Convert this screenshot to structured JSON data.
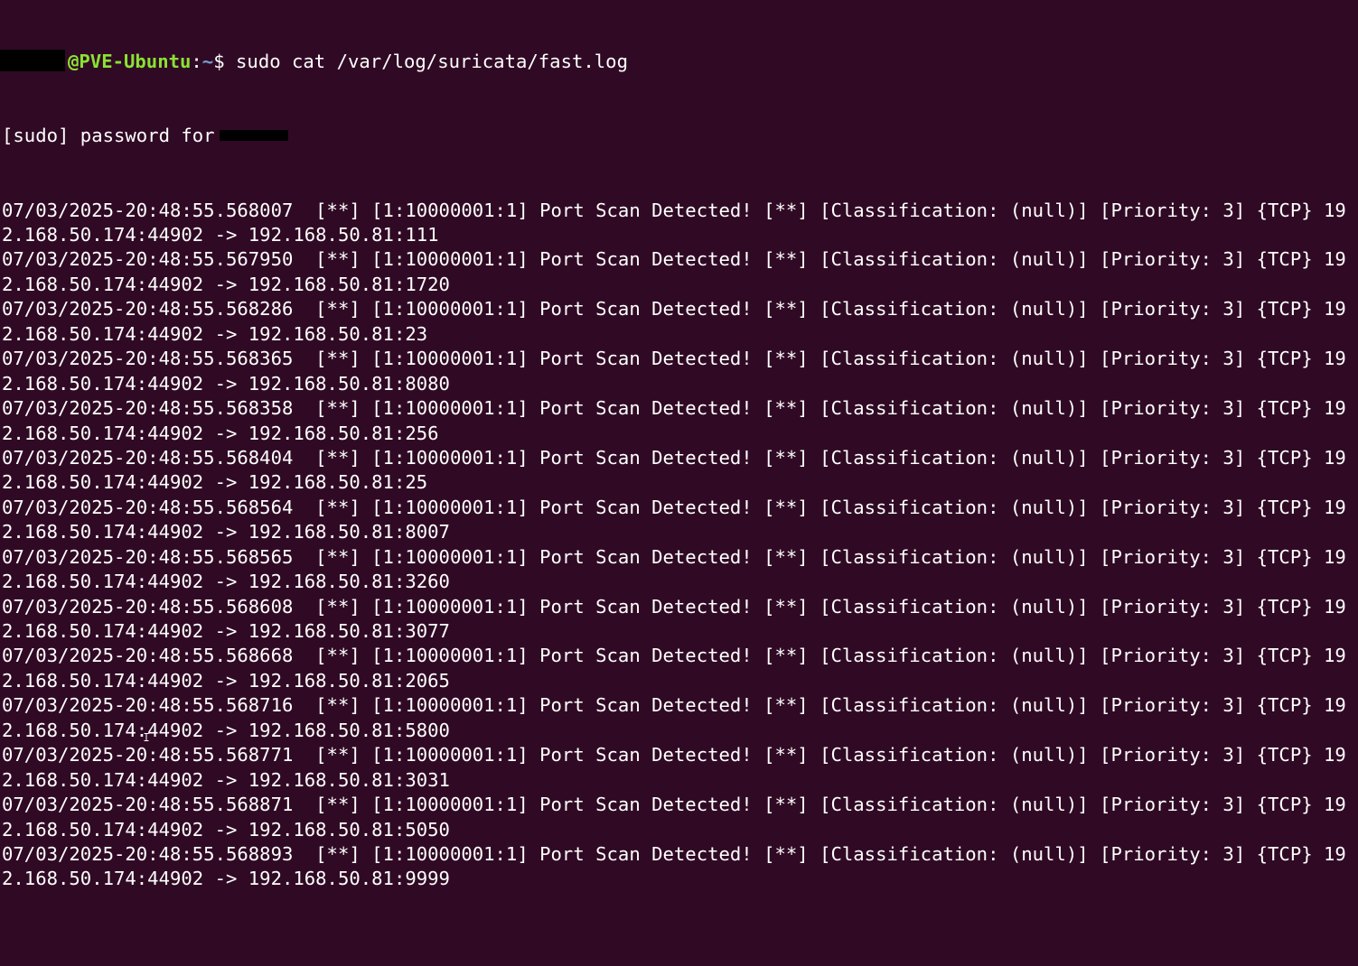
{
  "prompt": {
    "host": "@PVE-Ubuntu",
    "separator": ":",
    "path": "~",
    "symbol": "$",
    "command": "sudo cat /var/log/suricata/fast.log"
  },
  "sudo_prompt": "[sudo] password for",
  "entries": [
    {
      "head": "07/03/2025-20:48:55.568007  [**] [1:10000001:1] Port Scan Detected! [**] [Classification: (null)] [Priority: 3] {TCP} 19",
      "tail": "2.168.50.174:44902 -> 192.168.50.81:111"
    },
    {
      "head": "07/03/2025-20:48:55.567950  [**] [1:10000001:1] Port Scan Detected! [**] [Classification: (null)] [Priority: 3] {TCP} 19",
      "tail": "2.168.50.174:44902 -> 192.168.50.81:1720"
    },
    {
      "head": "07/03/2025-20:48:55.568286  [**] [1:10000001:1] Port Scan Detected! [**] [Classification: (null)] [Priority: 3] {TCP} 19",
      "tail": "2.168.50.174:44902 -> 192.168.50.81:23"
    },
    {
      "head": "07/03/2025-20:48:55.568365  [**] [1:10000001:1] Port Scan Detected! [**] [Classification: (null)] [Priority: 3] {TCP} 19",
      "tail": "2.168.50.174:44902 -> 192.168.50.81:8080"
    },
    {
      "head": "07/03/2025-20:48:55.568358  [**] [1:10000001:1] Port Scan Detected! [**] [Classification: (null)] [Priority: 3] {TCP} 19",
      "tail": "2.168.50.174:44902 -> 192.168.50.81:256"
    },
    {
      "head": "07/03/2025-20:48:55.568404  [**] [1:10000001:1] Port Scan Detected! [**] [Classification: (null)] [Priority: 3] {TCP} 19",
      "tail": "2.168.50.174:44902 -> 192.168.50.81:25"
    },
    {
      "head": "07/03/2025-20:48:55.568564  [**] [1:10000001:1] Port Scan Detected! [**] [Classification: (null)] [Priority: 3] {TCP} 19",
      "tail": "2.168.50.174:44902 -> 192.168.50.81:8007"
    },
    {
      "head": "07/03/2025-20:48:55.568565  [**] [1:10000001:1] Port Scan Detected! [**] [Classification: (null)] [Priority: 3] {TCP} 19",
      "tail": "2.168.50.174:44902 -> 192.168.50.81:3260"
    },
    {
      "head": "07/03/2025-20:48:55.568608  [**] [1:10000001:1] Port Scan Detected! [**] [Classification: (null)] [Priority: 3] {TCP} 19",
      "tail": "2.168.50.174:44902 -> 192.168.50.81:3077"
    },
    {
      "head": "07/03/2025-20:48:55.568668  [**] [1:10000001:1] Port Scan Detected! [**] [Classification: (null)] [Priority: 3] {TCP} 19",
      "tail": "2.168.50.174:44902 -> 192.168.50.81:2065"
    },
    {
      "head": "07/03/2025-20:48:55.568716  [**] [1:10000001:1] Port Scan Detected! [**] [Classification: (null)] [Priority: 3] {TCP} 19",
      "tail": "2.168.50.174:44902 -> 192.168.50.81:5800"
    },
    {
      "head": "07/03/2025-20:48:55.568771  [**] [1:10000001:1] Port Scan Detected! [**] [Classification: (null)] [Priority: 3] {TCP} 19",
      "tail": "2.168.50.174:44902 -> 192.168.50.81:3031"
    },
    {
      "head": "07/03/2025-20:48:55.568871  [**] [1:10000001:1] Port Scan Detected! [**] [Classification: (null)] [Priority: 3] {TCP} 19",
      "tail": "2.168.50.174:44902 -> 192.168.50.81:5050"
    },
    {
      "head": "07/03/2025-20:48:55.568893  [**] [1:10000001:1] Port Scan Detected! [**] [Classification: (null)] [Priority: 3] {TCP} 19",
      "tail": "2.168.50.174:44902 -> 192.168.50.81:9999"
    }
  ],
  "colors": {
    "background": "#300a24",
    "text": "#ffffff",
    "host": "#8ae234",
    "path": "#729fcf",
    "redaction": "#000000"
  },
  "icons": {
    "mouse_cursor": "i-beam-cursor-icon"
  }
}
